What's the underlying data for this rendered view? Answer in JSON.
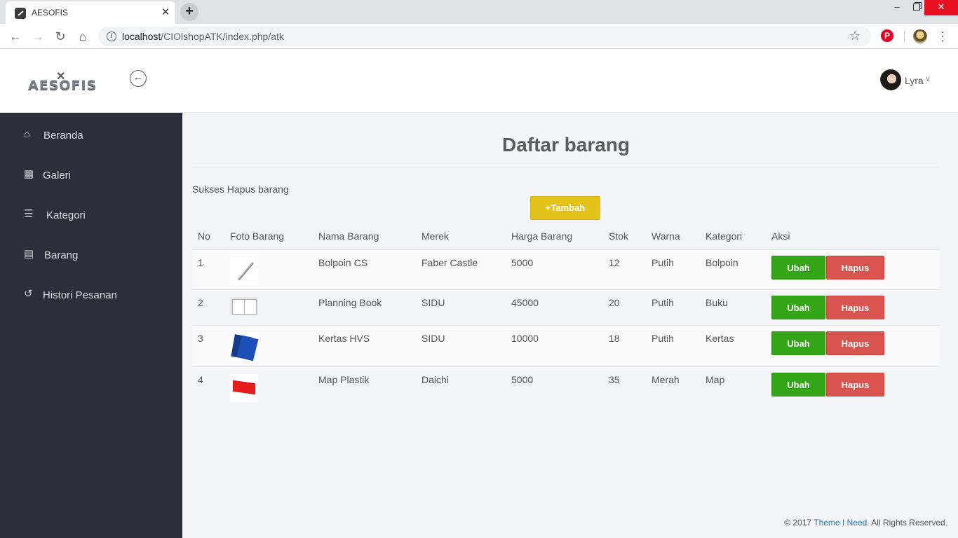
{
  "browser": {
    "tab_title": "AESOFIS",
    "tab_close": "✕",
    "new_tab": "+",
    "url_host": "localhost",
    "url_path": "/CIOlshopATK/index.php/atk"
  },
  "header": {
    "logo_text": "AESOFIS",
    "user_name": "Lyra"
  },
  "sidebar": {
    "items": [
      {
        "label": "Beranda",
        "icon": "home-icon"
      },
      {
        "label": "Galeri",
        "icon": "image-file-icon"
      },
      {
        "label": "Kategori",
        "icon": "list-icon"
      },
      {
        "label": "Barang",
        "icon": "list-alt-icon"
      },
      {
        "label": "Histori Pesanan",
        "icon": "history-icon"
      }
    ]
  },
  "main": {
    "title": "Daftar barang",
    "alert": "Sukses Hapus barang",
    "add_button": "+Tambah",
    "columns": [
      "No",
      "Foto Barang",
      "Nama Barang",
      "Merek",
      "Harga Barang",
      "Stok",
      "Warna",
      "Kategori",
      "Aksi"
    ],
    "rows": [
      {
        "no": "1",
        "photo": "pen-photo",
        "name": "Bolpoin CS",
        "brand": "Faber Castle",
        "price": "5000",
        "stock": "12",
        "color": "Putih",
        "category": "Bolpoin"
      },
      {
        "no": "2",
        "photo": "book-photo",
        "name": "Planning Book",
        "brand": "SIDU",
        "price": "45000",
        "stock": "20",
        "color": "Putih",
        "category": "Buku"
      },
      {
        "no": "3",
        "photo": "paper-photo",
        "name": "Kertas HVS",
        "brand": "SIDU",
        "price": "10000",
        "stock": "18",
        "color": "Putih",
        "category": "Kertas"
      },
      {
        "no": "4",
        "photo": "folder-photo",
        "name": "Map Plastik",
        "brand": "Daichi",
        "price": "5000",
        "stock": "35",
        "color": "Merah",
        "category": "Map"
      }
    ],
    "edit_label": "Ubah",
    "delete_label": "Hapus"
  },
  "footer": {
    "prefix": "© 2017 ",
    "link": "Theme I Need",
    "suffix": ". All Rights Reserved."
  },
  "colors": {
    "sidebar_bg": "#2a2f3a",
    "add_button": "#e3c21a",
    "edit_button": "#33a517",
    "delete_button": "#d9534f",
    "footer_link": "#2d76b5"
  }
}
